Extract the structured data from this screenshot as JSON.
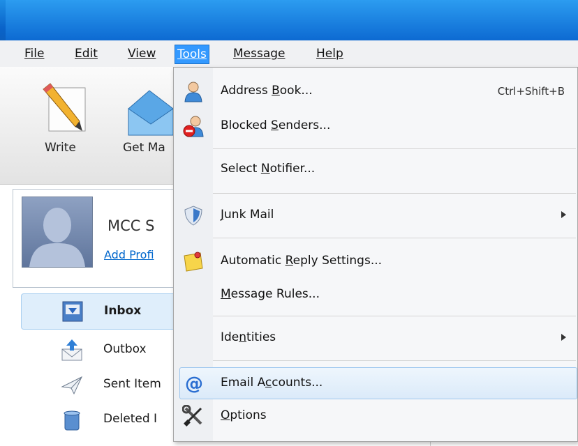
{
  "window": {
    "title": ""
  },
  "menubar": {
    "file": "File",
    "edit": "Edit",
    "view": "View",
    "tools": "Tools",
    "message": "Message",
    "help": "Help"
  },
  "toolbar": {
    "write": "Write",
    "get_mail": "Get Ma"
  },
  "profile": {
    "name": "MCC S",
    "add_profile": "Add Profi"
  },
  "folders": {
    "inbox": "Inbox",
    "outbox": "Outbox",
    "sent": "Sent Item",
    "deleted": "Deleted I"
  },
  "tools_menu": {
    "address_book": {
      "pre": "Address ",
      "acc": "B",
      "post": "ook...",
      "shortcut": "Ctrl+Shift+B"
    },
    "blocked_senders": {
      "pre": "Blocked ",
      "acc": "S",
      "post": "enders..."
    },
    "select_notifier": {
      "pre": "Select ",
      "acc": "N",
      "post": "otifier..."
    },
    "junk_mail": {
      "pre": "",
      "acc": "J",
      "post": "unk Mail"
    },
    "auto_reply": {
      "pre": "Automatic ",
      "acc": "R",
      "post": "eply Settings..."
    },
    "message_rules": {
      "pre": "",
      "acc": "M",
      "post": "essage Rules..."
    },
    "identities": {
      "pre": "Ide",
      "acc": "n",
      "post": "tities"
    },
    "email_accounts": {
      "pre": "Email A",
      "acc": "c",
      "post": "counts..."
    },
    "options": {
      "pre": "",
      "acc": "O",
      "post": "ptions"
    }
  },
  "colors": {
    "accent": "#3399ff",
    "titlebar": "#0d6ad2",
    "link": "#0066cc"
  }
}
